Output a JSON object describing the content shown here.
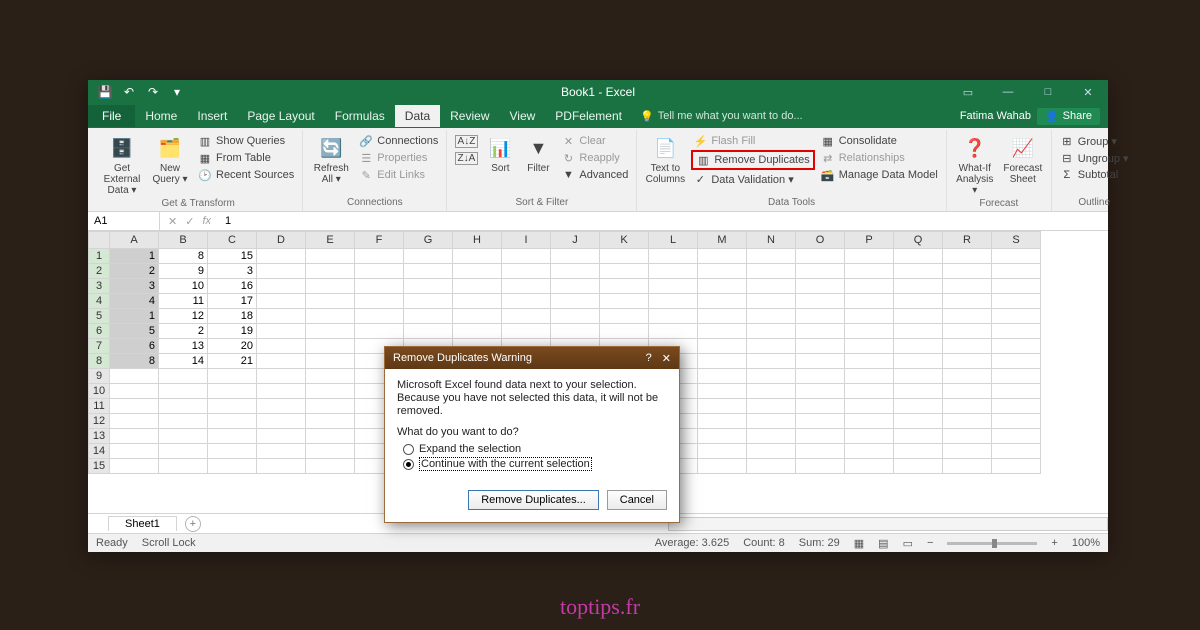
{
  "title": "Book1 - Excel",
  "user": "Fatima Wahab",
  "share": "Share",
  "tell_me": "Tell me what you want to do...",
  "qat": {
    "save": "💾",
    "undo": "↶",
    "redo": "↷"
  },
  "tabs": [
    "File",
    "Home",
    "Insert",
    "Page Layout",
    "Formulas",
    "Data",
    "Review",
    "View",
    "PDFelement"
  ],
  "active_tab": "Data",
  "ribbon": {
    "g1": {
      "label": "Get & Transform",
      "get_external": "Get External\nData ▾",
      "new_query": "New\nQuery ▾",
      "show_queries": "Show Queries",
      "from_table": "From Table",
      "recent": "Recent Sources"
    },
    "g2": {
      "label": "Connections",
      "refresh": "Refresh\nAll ▾",
      "connections": "Connections",
      "properties": "Properties",
      "edit_links": "Edit Links"
    },
    "g3": {
      "label": "Sort & Filter",
      "sort": "Sort",
      "filter": "Filter",
      "clear": "Clear",
      "reapply": "Reapply",
      "advanced": "Advanced"
    },
    "g4": {
      "label": "Data Tools",
      "text_cols": "Text to\nColumns",
      "flash": "Flash Fill",
      "remove_dupes": "Remove Duplicates",
      "data_val": "Data Validation  ▾",
      "consolidate": "Consolidate",
      "relationships": "Relationships",
      "manage_model": "Manage Data Model"
    },
    "g5": {
      "label": "Forecast",
      "whatif": "What-If\nAnalysis ▾",
      "forecast": "Forecast\nSheet"
    },
    "g6": {
      "label": "Outline",
      "group": "Group  ▾",
      "ungroup": "Ungroup  ▾",
      "subtotal": "Subtotal"
    }
  },
  "name_box": "A1",
  "formula": "1",
  "columns": [
    "A",
    "B",
    "C",
    "D",
    "E",
    "F",
    "G",
    "H",
    "I",
    "J",
    "K",
    "L",
    "M",
    "N",
    "O",
    "P",
    "Q",
    "R",
    "S"
  ],
  "rows": [
    "1",
    "2",
    "3",
    "4",
    "5",
    "6",
    "7",
    "8",
    "9",
    "10",
    "11",
    "12",
    "13",
    "14",
    "15"
  ],
  "cells": {
    "A": [
      1,
      2,
      3,
      4,
      1,
      5,
      6,
      8
    ],
    "B": [
      8,
      9,
      10,
      11,
      12,
      2,
      13,
      14
    ],
    "C": [
      15,
      3,
      16,
      17,
      18,
      19,
      20,
      21
    ]
  },
  "sheet_tab": "Sheet1",
  "status": {
    "ready": "Ready",
    "scroll": "Scroll Lock",
    "avg": "Average: 3.625",
    "count": "Count: 8",
    "sum": "Sum: 29",
    "zoom": "100%"
  },
  "dialog": {
    "title": "Remove Duplicates Warning",
    "msg": "Microsoft Excel found data next to your selection. Because you have not selected this data, it will not be removed.",
    "question": "What do you want to do?",
    "opt1": "Expand the selection",
    "opt2": "Continue with the current selection",
    "btn1": "Remove Duplicates...",
    "btn2": "Cancel"
  },
  "watermark": "toptips.fr"
}
